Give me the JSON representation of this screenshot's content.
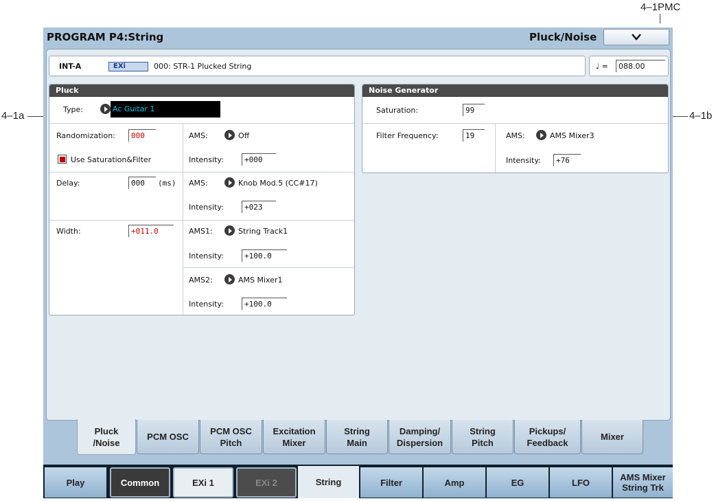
{
  "callouts": {
    "top_right": "4–1PMC",
    "left": "4–1a",
    "right": "4–1b"
  },
  "window": {
    "title": "PROGRAM P4:String",
    "page_name": "Pluck/Noise",
    "page_menu_icon": "chevron-down-icon"
  },
  "program_bar": {
    "bank": "INT-A",
    "engine_badge": "EXi",
    "program_name": "000: STR-1 Plucked String",
    "tempo_symbol": "♩ =",
    "tempo_value": "088.00"
  },
  "pluck": {
    "header": "Pluck",
    "type_label": "Type:",
    "type_value": "Ac Guitar 1",
    "randomization_label": "Randomization:",
    "randomization_value": "000",
    "ams1_label": "AMS:",
    "ams1_value": "Off",
    "use_sat_label": "Use Saturation&Filter",
    "use_sat_checked": true,
    "intensity1_label": "Intensity:",
    "intensity1_value": "+000",
    "delay_label": "Delay:",
    "delay_value": "000",
    "delay_unit": "(ms)",
    "ams2_label": "AMS:",
    "ams2_value": "Knob Mod.5 (CC#17)",
    "intensity2_label": "Intensity:",
    "intensity2_value": "+023",
    "width_label": "Width:",
    "width_value": "+011.0",
    "ams3_label": "AMS1:",
    "ams3_value": "String Track1",
    "intensity3_label": "Intensity:",
    "intensity3_value": "+100.0",
    "ams4_label": "AMS2:",
    "ams4_value": "AMS Mixer1",
    "intensity4_label": "Intensity:",
    "intensity4_value": "+100.0"
  },
  "noise": {
    "header": "Noise Generator",
    "saturation_label": "Saturation:",
    "saturation_value": "99",
    "filter_label": "Filter Frequency:",
    "filter_value": "19",
    "ams_label": "AMS:",
    "ams_value": "AMS Mixer3",
    "intensity_label": "Intensity:",
    "intensity_value": "+76"
  },
  "page_tabs": [
    {
      "label": "Pluck\n/Noise",
      "active": true
    },
    {
      "label": "PCM OSC",
      "active": false
    },
    {
      "label": "PCM OSC\nPitch",
      "active": false
    },
    {
      "label": "Excitation\nMixer",
      "active": false
    },
    {
      "label": "String\nMain",
      "active": false
    },
    {
      "label": "Damping/\nDispersion",
      "active": false
    },
    {
      "label": "String\nPitch",
      "active": false
    },
    {
      "label": "Pickups/\nFeedback",
      "active": false
    },
    {
      "label": "Mixer",
      "active": false
    }
  ],
  "bottom_tabs": [
    {
      "label": "Play"
    },
    {
      "label": "Common"
    },
    {
      "label": "EXi 1"
    },
    {
      "label": "EXi 2"
    },
    {
      "label": "String"
    },
    {
      "label": "Filter"
    },
    {
      "label": "Amp"
    },
    {
      "label": "EG"
    },
    {
      "label": "LFO"
    },
    {
      "label": "AMS Mixer\nString Trk"
    }
  ],
  "colors": {
    "screen_bg": "#adc5da",
    "panel_bg": "#e4ebf1",
    "header_bg": "#4a4a4a",
    "red_value": "#cc0000",
    "type_field_bg": "#000000",
    "type_field_text": "#00c8e8"
  }
}
